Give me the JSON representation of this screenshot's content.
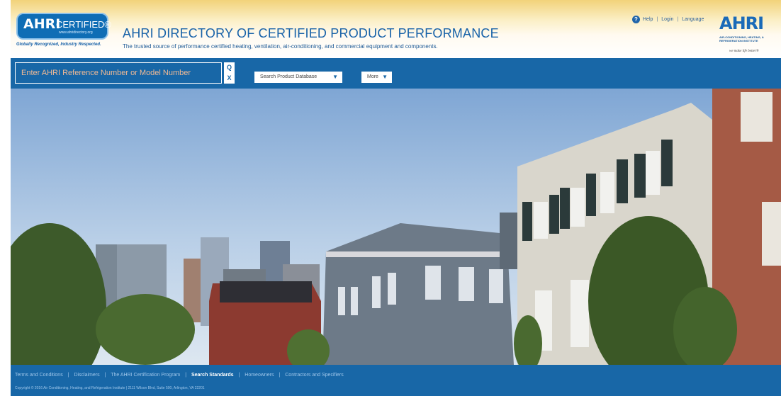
{
  "header": {
    "logo": {
      "text": "AHRI",
      "certified": "CERTIFIED®",
      "url": "www.ahridirectory.org",
      "tagline": "Globally Recognized, Industry Respected."
    },
    "title": "AHRI DIRECTORY OF CERTIFIED PRODUCT PERFORMANCE",
    "subtitle": "The trusted source of performance certified heating, ventilation, air-conditioning, and commercial equipment and components.",
    "links": [
      "Help",
      "Login",
      "Language"
    ],
    "org_logo": {
      "text": "AHRI",
      "name": "AIR-CONDITIONING, HEATING, & REFRIGERATION INSTITUTE",
      "motto": "we make life better®"
    }
  },
  "search": {
    "placeholder": "Enter AHRI Reference Number or Model Number",
    "search_icon": "Q",
    "clear_icon": "X",
    "product_db_label": "Search Product Database",
    "more_label": "More"
  },
  "footer": {
    "links": [
      "Terms and Conditions",
      "Disclaimers",
      "The AHRI Certification Program",
      "Search Standards",
      "Homeowners",
      "Contractors and Specifiers"
    ],
    "active_link": "Search Standards",
    "copyright": "Copyright © 2016 Air Conditioning, Heating, and Refrigeration Institute  |  2111 Wilson Blvd, Suite 500, Arlington, VA 22201"
  },
  "colors": {
    "brand_blue": "#1867a7",
    "title_blue": "#1862a8",
    "header_gold": "#f2d27a"
  }
}
